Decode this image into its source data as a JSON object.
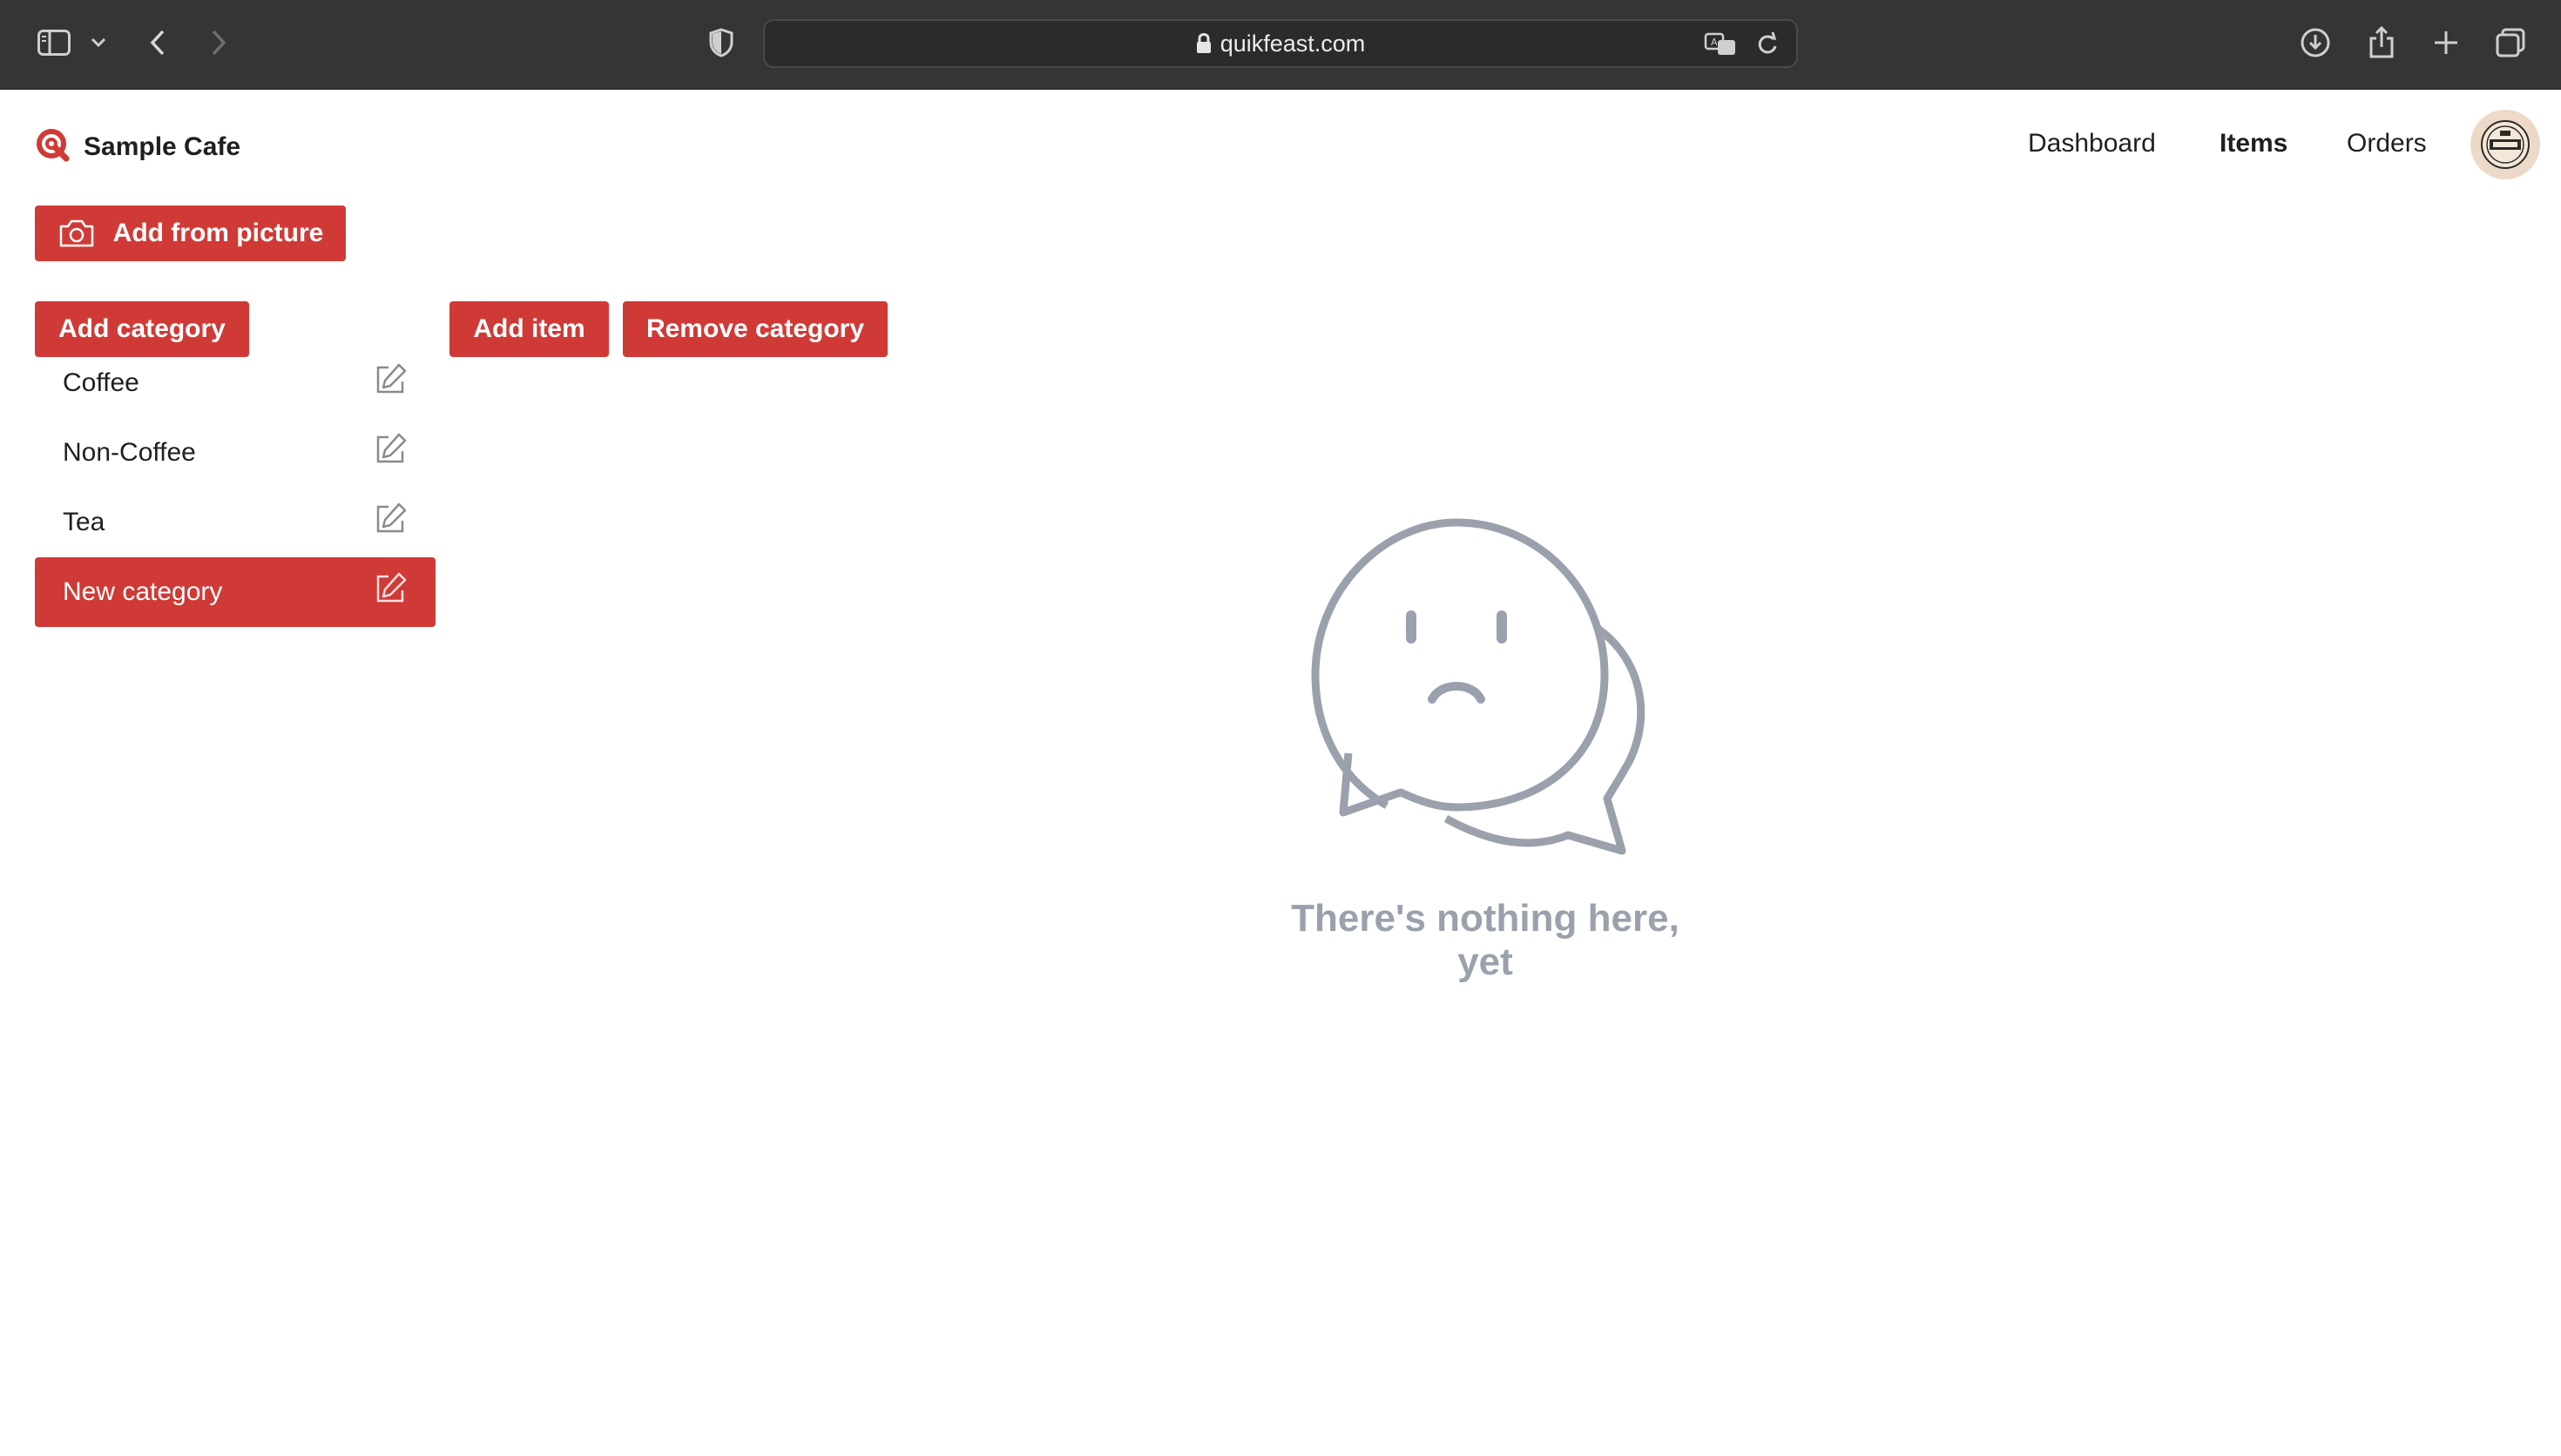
{
  "browser": {
    "url": "quikfeast.com"
  },
  "app": {
    "brand_name": "Sample Cafe",
    "brand_color": "#d03a36",
    "nav": [
      {
        "label": "Dashboard",
        "active": false
      },
      {
        "label": "Items",
        "active": true
      },
      {
        "label": "Orders",
        "active": false
      }
    ],
    "avatar_icon": "coffee-logo"
  },
  "toolbar": {
    "add_from_picture": "Add from picture",
    "add_category": "Add category",
    "add_item": "Add item",
    "remove_category": "Remove category"
  },
  "categories": [
    {
      "label": "Coffee",
      "selected": false
    },
    {
      "label": "Non-Coffee",
      "selected": false
    },
    {
      "label": "Tea",
      "selected": false
    },
    {
      "label": "New category",
      "selected": true
    }
  ],
  "empty_state": {
    "icon": "sad-chat-bubbles-icon",
    "message": "There's nothing here, yet"
  }
}
